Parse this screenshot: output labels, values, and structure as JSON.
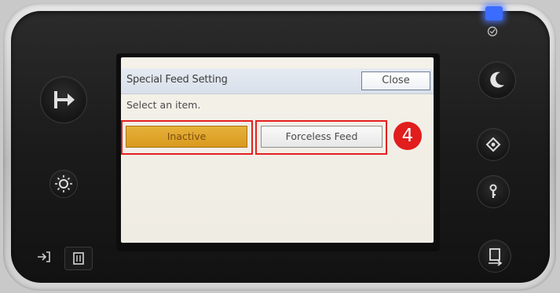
{
  "dialog": {
    "title": "Special Feed Setting",
    "close_label": "Close",
    "instruction": "Select an item.",
    "options": [
      {
        "label": "Inactive",
        "selected": true
      },
      {
        "label": "Forceless Feed",
        "selected": false
      }
    ]
  },
  "annotation": {
    "step_number": "4",
    "color": "#e11d1d"
  },
  "colors": {
    "selected_option": "#e0a42a",
    "title_bar": "#dce3ec",
    "screen_bg": "#f2efe7",
    "power_led": "#3a6cff"
  },
  "hardware_buttons": [
    {
      "name": "logout",
      "icon": "logout-arrow-icon"
    },
    {
      "name": "brightness",
      "icon": "brightness-icon"
    },
    {
      "name": "login",
      "icon": "login-arrow-icon"
    },
    {
      "name": "data-in",
      "icon": "data-in-icon"
    },
    {
      "name": "energy-saver",
      "icon": "moon-icon"
    },
    {
      "name": "check-status",
      "icon": "diamond-icon"
    },
    {
      "name": "user-tools",
      "icon": "key-icon"
    },
    {
      "name": "media",
      "icon": "media-slot-icon"
    },
    {
      "name": "main-power",
      "icon": "power-status-icon"
    }
  ]
}
